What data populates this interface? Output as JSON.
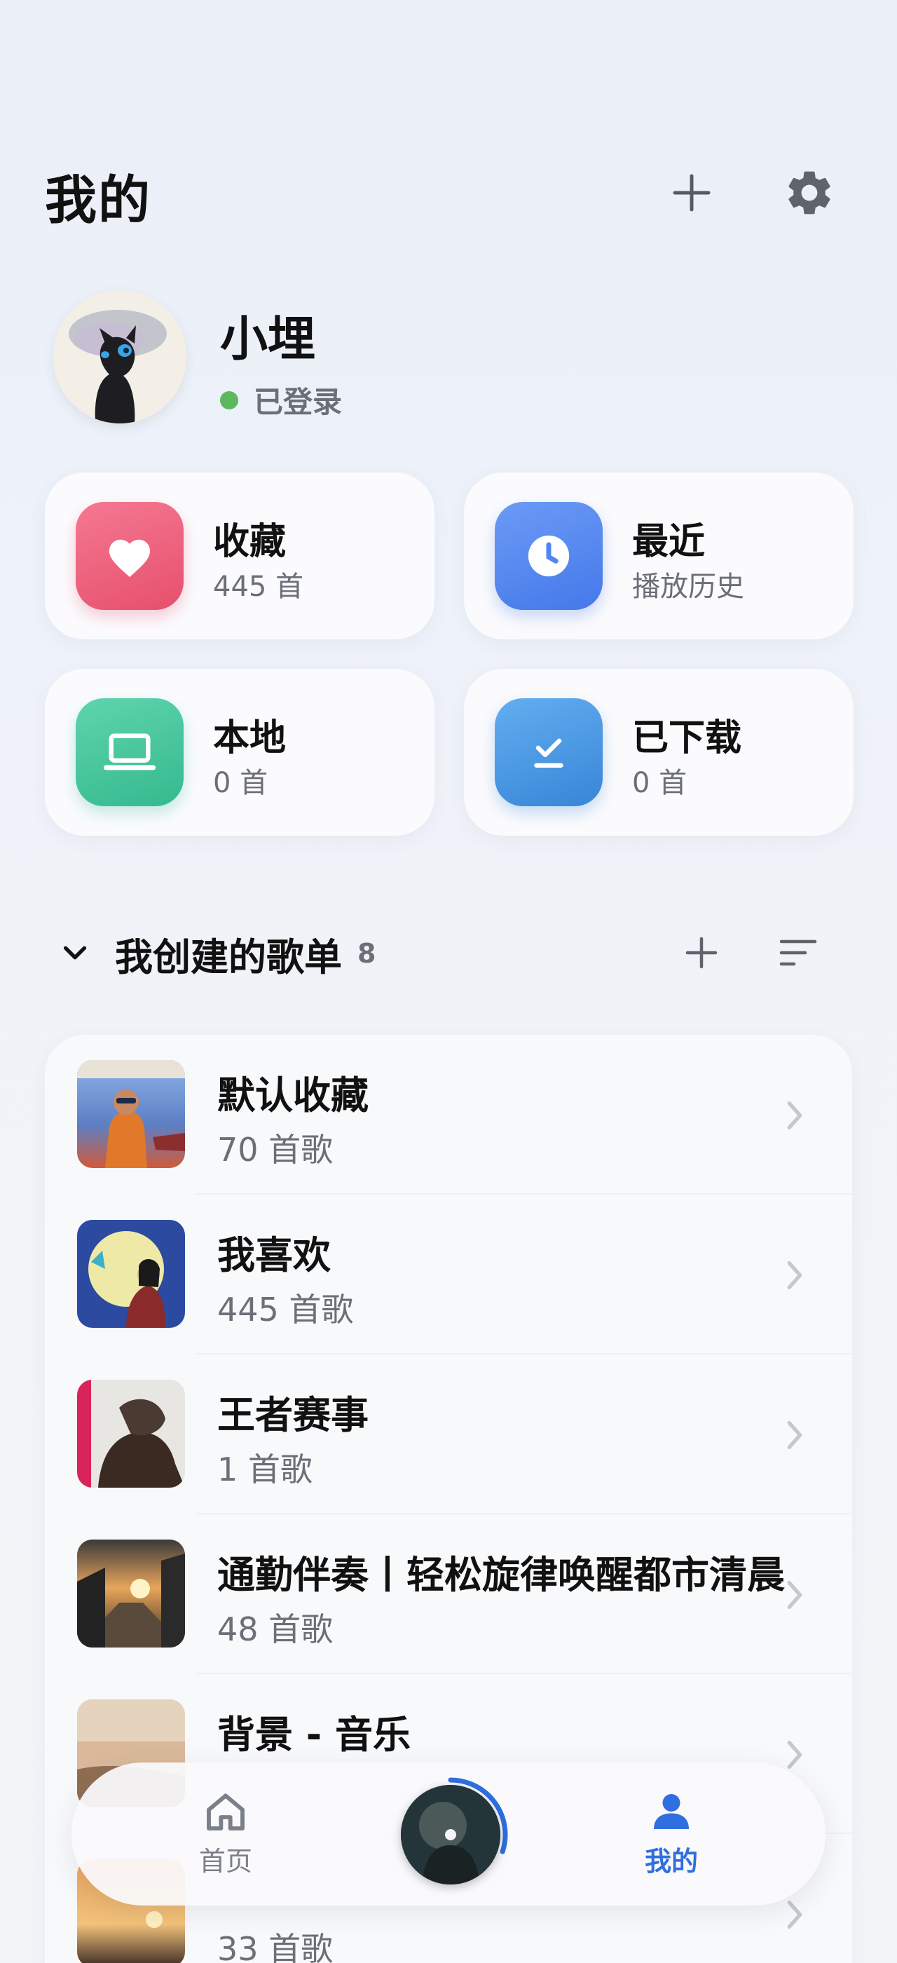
{
  "header": {
    "title": "我的"
  },
  "profile": {
    "name": "小埋",
    "status": "已登录"
  },
  "cards": [
    {
      "title": "收藏",
      "subtitle": "445 首",
      "icon": "heart-icon",
      "color": "#ef5b78"
    },
    {
      "title": "最近",
      "subtitle": "播放历史",
      "icon": "clock-icon",
      "color": "#4f86f0"
    },
    {
      "title": "本地",
      "subtitle": "0 首",
      "icon": "laptop-icon",
      "color": "#3cc49a"
    },
    {
      "title": "已下载",
      "subtitle": "0 首",
      "icon": "download-check-icon",
      "color": "#3f8fdf"
    }
  ],
  "section": {
    "title": "我创建的歌单",
    "count": "8"
  },
  "playlists": [
    {
      "title": "默认收藏",
      "count": "70 首歌"
    },
    {
      "title": "我喜欢",
      "count": "445 首歌"
    },
    {
      "title": "王者赛事",
      "count": "1 首歌"
    },
    {
      "title": "通勤伴奏丨轻松旋律唤醒都市清晨",
      "count": "48 首歌"
    },
    {
      "title": "背景 - 音乐",
      "count": ""
    },
    {
      "title": "",
      "count": "33 首歌"
    }
  ],
  "tabbar": {
    "home_label": "首页",
    "mine_label": "我的",
    "active_color": "#2f6fe0",
    "inactive_color": "#7a7f88",
    "playback_progress": 0.3
  }
}
